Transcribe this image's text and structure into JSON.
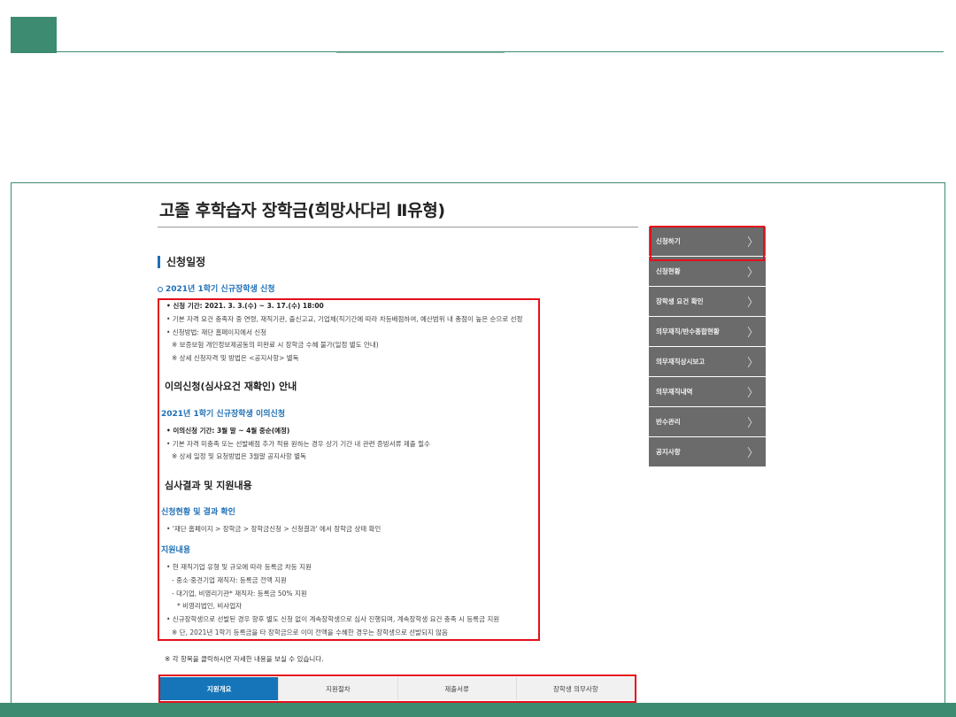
{
  "page": {
    "title": "고졸 후학습자 장학금(희망사다리 Ⅱ유형)",
    "section_title": "신청일정"
  },
  "apply": {
    "subtitle": "2021년 1학기 신규장학생 신청",
    "lines": [
      "• 신청 기간: 2021. 3. 3.(수) ~ 3. 17.(수) 18:00",
      "• 기본 자격 요건 충족자 중 연령, 재직기관, 출신고교, 기업체(직기간에 따라 차등배점하여, 예산범위 내 총점이 높은 순으로 선정",
      "• 신청방법: 재단 홈페이지에서 신청",
      "※ 보증보험 개인정보제공동의 미완료 시 장학금 수혜 불가(일정 별도 안내)",
      "※ 상세 신청자격 및 방법은 <공지사항> 별독"
    ]
  },
  "appeal": {
    "heading": "이의신청(심사요건 재확인) 안내",
    "subtitle": "2021년 1학기 신규장학생 이의신청",
    "lines": [
      "• 이의신청 기간: 3월 말 ~ 4월 중순(예정)",
      "• 기본 자격 미충족 또는 선발배점 추가 적용 원하는 경우 상기 기간 내 관련 증빙서류 제출 필수",
      "※ 상세 일정 및 요청방법은 3월말 공지사항 별독"
    ]
  },
  "result": {
    "heading": "심사결과 및 지원내용",
    "check_subtitle": "신청현황 및 결과 확인",
    "check_line": "• '재단 홈페이지 > 장학금 > 장학금신청 > 신청결과' 에서 장학금 상태 확인",
    "support_subtitle": "지원내용",
    "support_lines": [
      "• 현 재직기업 유형 및 규모에 따라 등록금 차등 지원",
      "- 중소·중견기업 재직자: 등록금 전액 지원",
      "- 대기업, 비영리기관* 재직자: 등록금 50% 지원",
      "* 비영리법인, 비사업자",
      "• 신규장학생으로 선발된 경우 향후 별도 신청 없이 계속장학생으로 심사 진행되며, 계속장학생 요건 충족 시 등록금 지원",
      "※ 단, 2021년 1학기 등록금을 타 장학금으로 이미 전액을 수혜한 경우는 장학생으로 선발되지 않음"
    ]
  },
  "notice": "※ 각 항목을 클릭하시면 자세한 내용을 보실 수 있습니다.",
  "tabs": [
    "지원개요",
    "지원절차",
    "제출서류",
    "장학생 의무사항"
  ],
  "sidebar": {
    "items": [
      "신청하기",
      "신청현황",
      "장학생 요건 확인",
      "의무재직/반수종합현황",
      "의무재직상시보고",
      "의무재직내역",
      "반수관리",
      "공지사항"
    ],
    "chevron": "〉"
  },
  "colors": {
    "accent_green": "#3d8b70",
    "tab_active_blue": "#1575b8",
    "highlight_red": "#e3101c",
    "sidebar_gray": "#6b6b6b"
  }
}
